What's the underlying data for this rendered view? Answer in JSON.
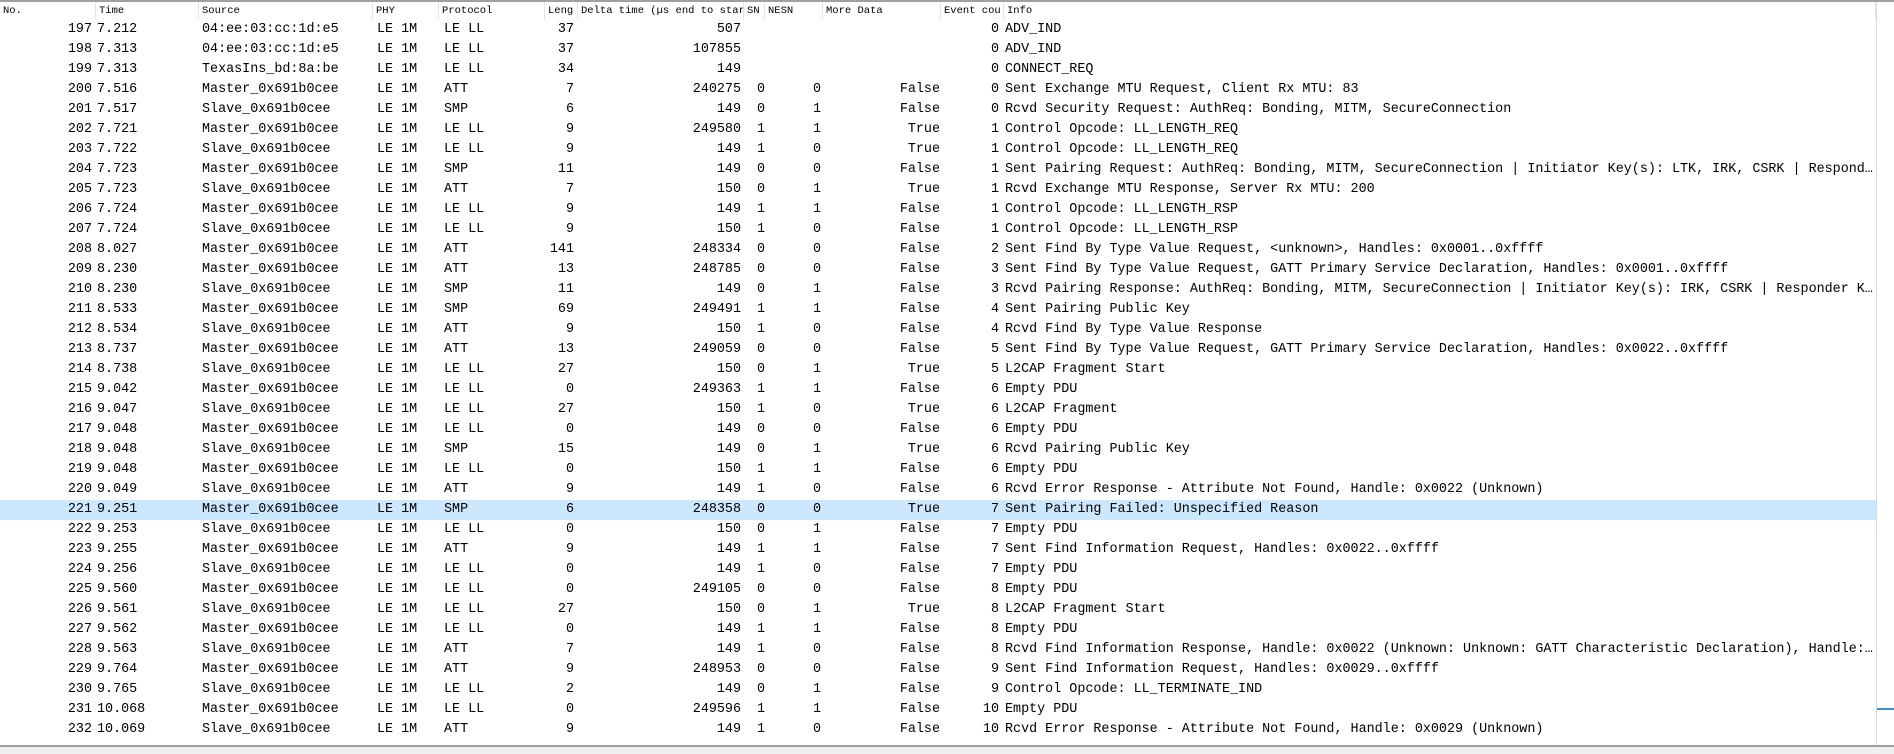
{
  "columns": [
    "No.",
    "Time",
    "Source",
    "PHY",
    "Protocol",
    "Leng",
    "Delta time (µs end to star",
    "SN",
    "NESN",
    "More Data",
    "Event cou",
    "Info"
  ],
  "selected_no": "221",
  "selection_color": "#cce8ff",
  "rows": [
    [
      "197",
      "7.212",
      "04:ee:03:cc:1d:e5",
      "LE 1M",
      "LE LL",
      "37",
      "507",
      "",
      "",
      "",
      "0",
      "ADV_IND"
    ],
    [
      "198",
      "7.313",
      "04:ee:03:cc:1d:e5",
      "LE 1M",
      "LE LL",
      "37",
      "107855",
      "",
      "",
      "",
      "0",
      "ADV_IND"
    ],
    [
      "199",
      "7.313",
      "TexasIns_bd:8a:be",
      "LE 1M",
      "LE LL",
      "34",
      "149",
      "",
      "",
      "",
      "0",
      "CONNECT_REQ"
    ],
    [
      "200",
      "7.516",
      "Master_0x691b0cee",
      "LE 1M",
      "ATT",
      "7",
      "240275",
      "0",
      "0",
      "False",
      "0",
      "Sent Exchange MTU Request, Client Rx MTU: 83"
    ],
    [
      "201",
      "7.517",
      "Slave_0x691b0cee",
      "LE 1M",
      "SMP",
      "6",
      "149",
      "0",
      "1",
      "False",
      "0",
      "Rcvd Security Request: AuthReq: Bonding, MITM, SecureConnection"
    ],
    [
      "202",
      "7.721",
      "Master_0x691b0cee",
      "LE 1M",
      "LE LL",
      "9",
      "249580",
      "1",
      "1",
      "True",
      "1",
      "Control Opcode: LL_LENGTH_REQ"
    ],
    [
      "203",
      "7.722",
      "Slave_0x691b0cee",
      "LE 1M",
      "LE LL",
      "9",
      "149",
      "1",
      "0",
      "True",
      "1",
      "Control Opcode: LL_LENGTH_REQ"
    ],
    [
      "204",
      "7.723",
      "Master_0x691b0cee",
      "LE 1M",
      "SMP",
      "11",
      "149",
      "0",
      "0",
      "False",
      "1",
      "Sent Pairing Request: AuthReq: Bonding, MITM, SecureConnection | Initiator Key(s): LTK, IRK, CSRK | Respond…"
    ],
    [
      "205",
      "7.723",
      "Slave_0x691b0cee",
      "LE 1M",
      "ATT",
      "7",
      "150",
      "0",
      "1",
      "True",
      "1",
      "Rcvd Exchange MTU Response, Server Rx MTU: 200"
    ],
    [
      "206",
      "7.724",
      "Master_0x691b0cee",
      "LE 1M",
      "LE LL",
      "9",
      "149",
      "1",
      "1",
      "False",
      "1",
      "Control Opcode: LL_LENGTH_RSP"
    ],
    [
      "207",
      "7.724",
      "Slave_0x691b0cee",
      "LE 1M",
      "LE LL",
      "9",
      "150",
      "1",
      "0",
      "False",
      "1",
      "Control Opcode: LL_LENGTH_RSP"
    ],
    [
      "208",
      "8.027",
      "Master_0x691b0cee",
      "LE 1M",
      "ATT",
      "141",
      "248334",
      "0",
      "0",
      "False",
      "2",
      "Sent Find By Type Value Request, <unknown>, Handles: 0x0001..0xffff"
    ],
    [
      "209",
      "8.230",
      "Master_0x691b0cee",
      "LE 1M",
      "ATT",
      "13",
      "248785",
      "0",
      "0",
      "False",
      "3",
      "Sent Find By Type Value Request, GATT Primary Service Declaration, Handles: 0x0001..0xffff"
    ],
    [
      "210",
      "8.230",
      "Slave_0x691b0cee",
      "LE 1M",
      "SMP",
      "11",
      "149",
      "0",
      "1",
      "False",
      "3",
      "Rcvd Pairing Response: AuthReq: Bonding, MITM, SecureConnection | Initiator Key(s): IRK, CSRK | Responder K…"
    ],
    [
      "211",
      "8.533",
      "Master_0x691b0cee",
      "LE 1M",
      "SMP",
      "69",
      "249491",
      "1",
      "1",
      "False",
      "4",
      "Sent Pairing Public Key"
    ],
    [
      "212",
      "8.534",
      "Slave_0x691b0cee",
      "LE 1M",
      "ATT",
      "9",
      "150",
      "1",
      "0",
      "False",
      "4",
      "Rcvd Find By Type Value Response"
    ],
    [
      "213",
      "8.737",
      "Master_0x691b0cee",
      "LE 1M",
      "ATT",
      "13",
      "249059",
      "0",
      "0",
      "False",
      "5",
      "Sent Find By Type Value Request, GATT Primary Service Declaration, Handles: 0x0022..0xffff"
    ],
    [
      "214",
      "8.738",
      "Slave_0x691b0cee",
      "LE 1M",
      "LE LL",
      "27",
      "150",
      "0",
      "1",
      "True",
      "5",
      "L2CAP Fragment Start"
    ],
    [
      "215",
      "9.042",
      "Master_0x691b0cee",
      "LE 1M",
      "LE LL",
      "0",
      "249363",
      "1",
      "1",
      "False",
      "6",
      "Empty PDU"
    ],
    [
      "216",
      "9.047",
      "Slave_0x691b0cee",
      "LE 1M",
      "LE LL",
      "27",
      "150",
      "1",
      "0",
      "True",
      "6",
      "L2CAP Fragment"
    ],
    [
      "217",
      "9.048",
      "Master_0x691b0cee",
      "LE 1M",
      "LE LL",
      "0",
      "149",
      "0",
      "0",
      "False",
      "6",
      "Empty PDU"
    ],
    [
      "218",
      "9.048",
      "Slave_0x691b0cee",
      "LE 1M",
      "SMP",
      "15",
      "149",
      "0",
      "1",
      "True",
      "6",
      "Rcvd Pairing Public Key"
    ],
    [
      "219",
      "9.048",
      "Master_0x691b0cee",
      "LE 1M",
      "LE LL",
      "0",
      "150",
      "1",
      "1",
      "False",
      "6",
      "Empty PDU"
    ],
    [
      "220",
      "9.049",
      "Slave_0x691b0cee",
      "LE 1M",
      "ATT",
      "9",
      "149",
      "1",
      "0",
      "False",
      "6",
      "Rcvd Error Response - Attribute Not Found, Handle: 0x0022 (Unknown)"
    ],
    [
      "221",
      "9.251",
      "Master_0x691b0cee",
      "LE 1M",
      "SMP",
      "6",
      "248358",
      "0",
      "0",
      "True",
      "7",
      "Sent Pairing Failed: Unspecified Reason"
    ],
    [
      "222",
      "9.253",
      "Slave_0x691b0cee",
      "LE 1M",
      "LE LL",
      "0",
      "150",
      "0",
      "1",
      "False",
      "7",
      "Empty PDU"
    ],
    [
      "223",
      "9.255",
      "Master_0x691b0cee",
      "LE 1M",
      "ATT",
      "9",
      "149",
      "1",
      "1",
      "False",
      "7",
      "Sent Find Information Request, Handles: 0x0022..0xffff"
    ],
    [
      "224",
      "9.256",
      "Slave_0x691b0cee",
      "LE 1M",
      "LE LL",
      "0",
      "149",
      "1",
      "0",
      "False",
      "7",
      "Empty PDU"
    ],
    [
      "225",
      "9.560",
      "Master_0x691b0cee",
      "LE 1M",
      "LE LL",
      "0",
      "249105",
      "0",
      "0",
      "False",
      "8",
      "Empty PDU"
    ],
    [
      "226",
      "9.561",
      "Slave_0x691b0cee",
      "LE 1M",
      "LE LL",
      "27",
      "150",
      "0",
      "1",
      "True",
      "8",
      "L2CAP Fragment Start"
    ],
    [
      "227",
      "9.562",
      "Master_0x691b0cee",
      "LE 1M",
      "LE LL",
      "0",
      "149",
      "1",
      "1",
      "False",
      "8",
      "Empty PDU"
    ],
    [
      "228",
      "9.563",
      "Slave_0x691b0cee",
      "LE 1M",
      "ATT",
      "7",
      "149",
      "1",
      "0",
      "False",
      "8",
      "Rcvd Find Information Response, Handle: 0x0022 (Unknown: Unknown: GATT Characteristic Declaration), Handle:…"
    ],
    [
      "229",
      "9.764",
      "Master_0x691b0cee",
      "LE 1M",
      "ATT",
      "9",
      "248953",
      "0",
      "0",
      "False",
      "9",
      "Sent Find Information Request, Handles: 0x0029..0xffff"
    ],
    [
      "230",
      "9.765",
      "Slave_0x691b0cee",
      "LE 1M",
      "LE LL",
      "2",
      "149",
      "0",
      "1",
      "False",
      "9",
      "Control Opcode: LL_TERMINATE_IND"
    ],
    [
      "231",
      "10.068",
      "Master_0x691b0cee",
      "LE 1M",
      "LE LL",
      "0",
      "249596",
      "1",
      "1",
      "False",
      "10",
      "Empty PDU"
    ],
    [
      "232",
      "10.069",
      "Slave_0x691b0cee",
      "LE 1M",
      "ATT",
      "9",
      "149",
      "1",
      "0",
      "False",
      "10",
      "Rcvd Error Response - Attribute Not Found, Handle: 0x0029 (Unknown)"
    ]
  ]
}
